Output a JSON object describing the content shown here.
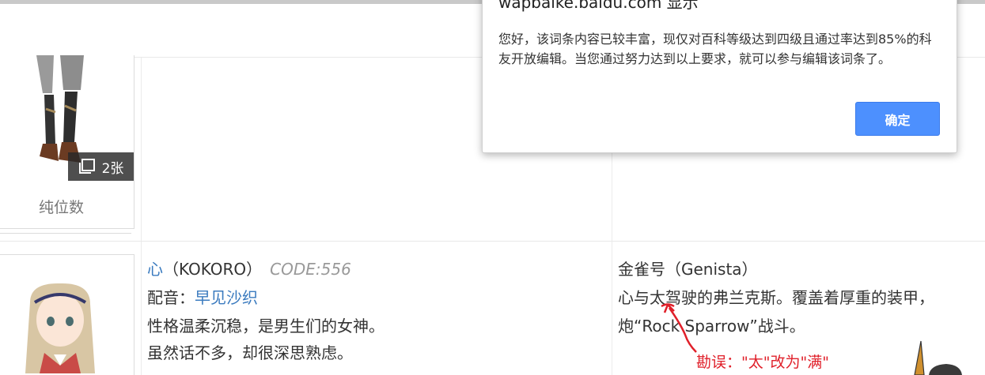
{
  "dialog": {
    "title": "wapbaike.baidu.com 显示",
    "message": "您好，该词条内容已较丰富，现仅对百科等级达到四级且通过率达到85%的科友开放编辑。当您通过努力达到以上要求，就可以参与编辑该词条了。",
    "ok_label": "确定"
  },
  "gallery_1": {
    "count_label": "2张",
    "caption": "纯位数",
    "icon": "gallery-icon"
  },
  "character": {
    "name": "心",
    "paren_open": "（",
    "name_en": "KOKORO",
    "paren_close": "）",
    "code": "CODE:556",
    "va_label": "配音：",
    "va_name": "早见沙织",
    "desc_1": "性格温柔沉稳，是男生们的女神。",
    "desc_2": "虽然话不多，却很深思熟虑。"
  },
  "mecha": {
    "name": "金雀号（Genista）",
    "desc_1": "心与太驾驶的弗兰克斯。覆盖着厚重的装甲，",
    "desc_2": "炮“Rock Sparrow”战斗。"
  },
  "annotation": {
    "text": "勘误：\"太\"改为\"满\"",
    "color": "#e0202a"
  },
  "colors": {
    "link": "#3b7bbf",
    "button": "#4d90fe"
  }
}
